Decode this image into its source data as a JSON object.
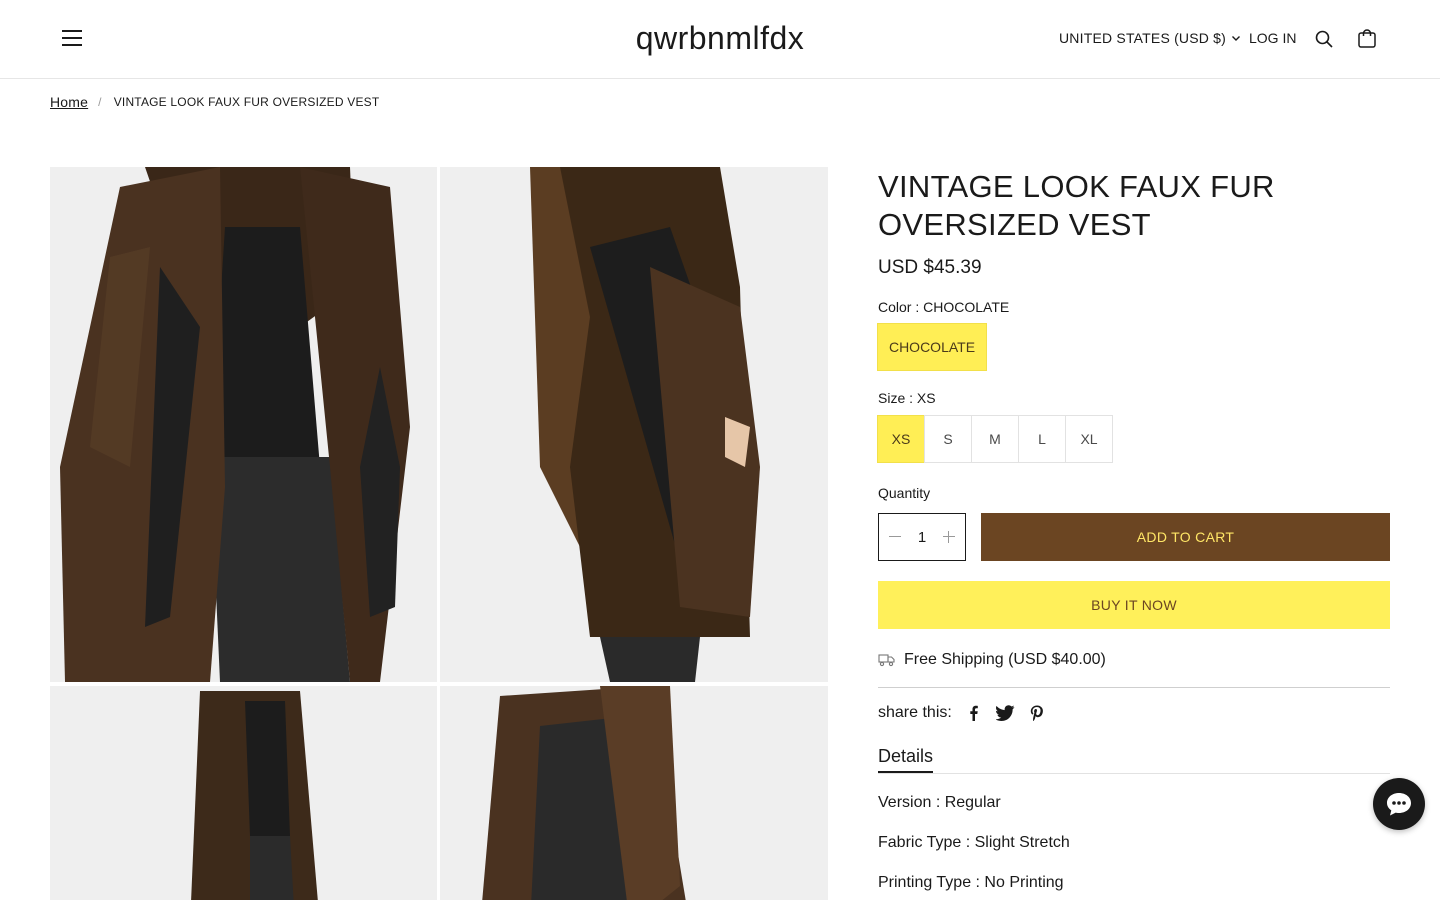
{
  "header": {
    "brand": "qwrbnmlfdx",
    "currency": "UNITED STATES (USD $)",
    "login": "LOG IN"
  },
  "breadcrumb": {
    "home": "Home",
    "separator": "/",
    "current": "VINTAGE LOOK FAUX FUR OVERSIZED VEST"
  },
  "product": {
    "title": "VINTAGE LOOK FAUX FUR OVERSIZED VEST",
    "price": "USD $45.39",
    "color_label": "Color : CHOCOLATE",
    "color_option": "CHOCOLATE",
    "size_label": "Size : XS",
    "sizes": [
      "XS",
      "S",
      "M",
      "L",
      "XL"
    ],
    "selected_size": "XS",
    "quantity_label": "Quantity",
    "quantity": "1",
    "add_to_cart": "ADD TO CART",
    "buy_now": "BUY IT NOW",
    "shipping": "Free Shipping (USD $40.00)",
    "share_label": "share this:",
    "details_tab": "Details",
    "details": [
      "Version : Regular",
      "Fabric Type : Slight Stretch",
      "Printing Type : No Printing"
    ]
  },
  "colors": {
    "accent_yellow": "#ffee55",
    "add_to_cart_bg": "#6b4522",
    "add_to_cart_text": "#ffe666",
    "buy_now_bg": "#fff05a"
  }
}
